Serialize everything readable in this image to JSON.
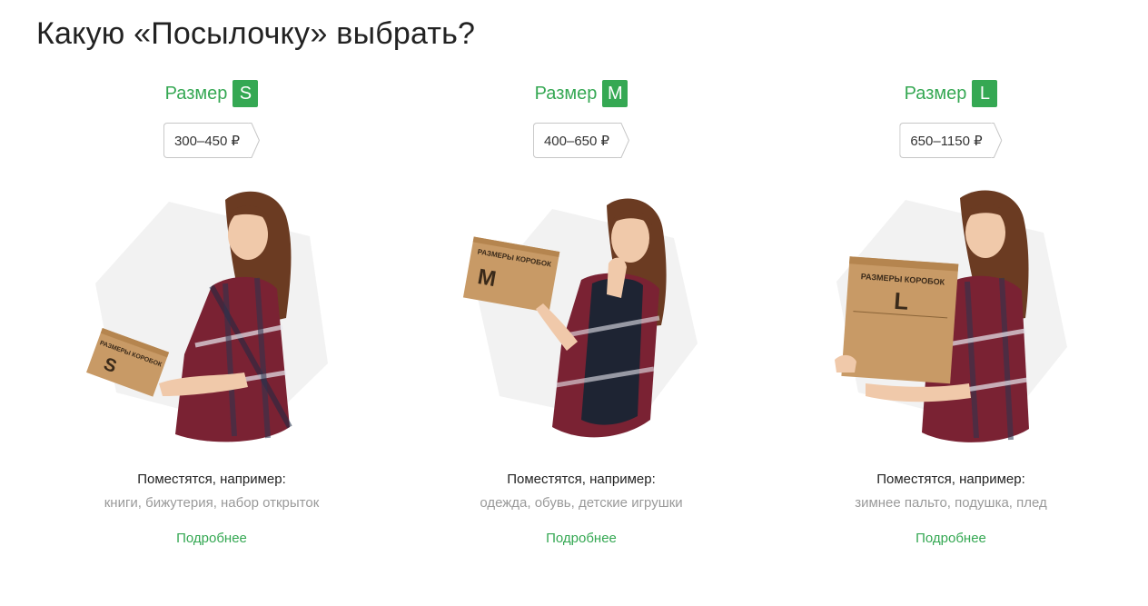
{
  "page": {
    "title": "Какую «Посылочку» выбрать?"
  },
  "cards": [
    {
      "size_word": "Размер",
      "size_letter": "S",
      "price": "300–450 ₽",
      "fits_label": "Поместятся, например:",
      "examples": "книги, бижутерия, набор открыток",
      "more_link": "Подробнее",
      "box_caption": "РАЗМЕРЫ КОРОБОК"
    },
    {
      "size_word": "Размер",
      "size_letter": "M",
      "price": "400–650 ₽",
      "fits_label": "Поместятся, например:",
      "examples": "одежда, обувь, детские игрушки",
      "more_link": "Подробнее",
      "box_caption": "РАЗМЕРЫ КОРОБОК"
    },
    {
      "size_word": "Размер",
      "size_letter": "L",
      "price": "650–1150 ₽",
      "fits_label": "Поместятся, например:",
      "examples": "зимнее пальто, подушка, плед",
      "more_link": "Подробнее",
      "box_caption": "РАЗМЕРЫ КОРОБОК"
    }
  ],
  "colors": {
    "accent": "#35a853",
    "muted_text": "#9a9a9a",
    "hexagon": "#f2f2f2",
    "box": "#c89a66"
  },
  "icons": {
    "price_tag": "tag-arrow-icon"
  }
}
